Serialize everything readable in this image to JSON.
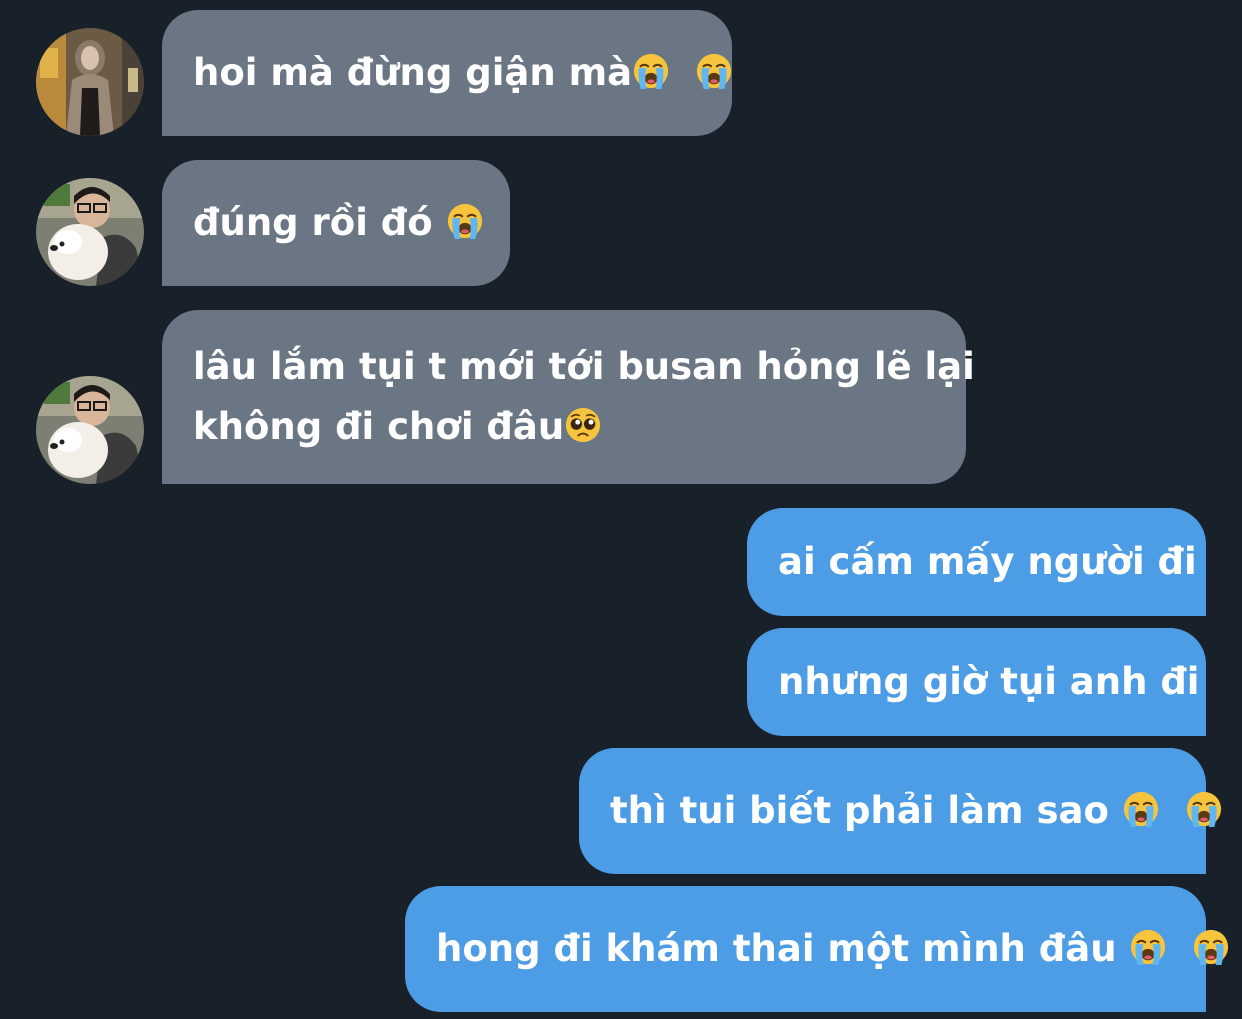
{
  "messages": [
    {
      "sender": "them",
      "text": "hoi mà đừng giận mà",
      "emojis": [
        "loudly-crying-face",
        "loudly-crying-face"
      ]
    },
    {
      "sender": "them",
      "text": "đúng rồi đó ",
      "emojis": [
        "loudly-crying-face"
      ]
    },
    {
      "sender": "them",
      "text_line1": "lâu lắm tụi t mới tới busan hỏng lẽ lại",
      "text_line2": "không đi chơi đâu",
      "emojis": [
        "pleading-face"
      ]
    },
    {
      "sender": "me",
      "text": "ai cấm mấy người đi"
    },
    {
      "sender": "me",
      "text": "nhưng giờ tụi anh đi"
    },
    {
      "sender": "me",
      "text": "thì tui biết phải làm sao ",
      "emojis": [
        "loudly-crying-face",
        "loudly-crying-face"
      ]
    },
    {
      "sender": "me",
      "text": "hong đi khám thai một mình đâu ",
      "emojis": [
        "loudly-crying-face",
        "loudly-crying-face"
      ]
    }
  ],
  "colors": {
    "background": "#18202a",
    "incoming_bubble": "#6a7683",
    "outgoing_bubble": "#4d9de6",
    "text": "#ffffff"
  }
}
